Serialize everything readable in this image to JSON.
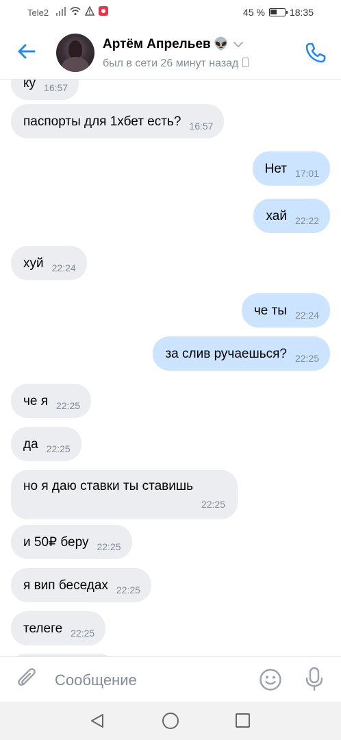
{
  "status_bar": {
    "carrier": "Tele2",
    "battery": "45 %",
    "time": "18:35"
  },
  "header": {
    "name": "Артём Апрельев",
    "emoji": "👽",
    "last_seen": "был в сети 26 минут назад"
  },
  "messages": [
    {
      "dir": "in",
      "text": "ку",
      "time": "16:57"
    },
    {
      "dir": "in",
      "text": "паспорты для 1хбет есть?",
      "time": "16:57"
    },
    {
      "dir": "out",
      "text": "Нет",
      "time": "17:01"
    },
    {
      "dir": "out",
      "text": "хай",
      "time": "22:22"
    },
    {
      "dir": "in",
      "text": "хуй",
      "time": "22:24"
    },
    {
      "dir": "out",
      "text": "че ты",
      "time": "22:24"
    },
    {
      "dir": "out",
      "text": "за слив ручаешься?",
      "time": "22:25"
    },
    {
      "dir": "in",
      "text": "че я",
      "time": "22:25"
    },
    {
      "dir": "in",
      "text": "да",
      "time": "22:25"
    },
    {
      "dir": "in",
      "text": "но я даю ставки ты ставишь",
      "time": "22:25"
    },
    {
      "dir": "in",
      "text": "и 50₽ беру",
      "time": "22:25"
    },
    {
      "dir": "in",
      "text": "я вип беседах",
      "time": "22:25"
    },
    {
      "dir": "in",
      "text": "телеге",
      "time": "22:25"
    }
  ],
  "composer": {
    "placeholder": "Сообщение"
  },
  "colors": {
    "accent": "#2688eb",
    "incoming": "#ebedf0",
    "outgoing": "#cce4ff",
    "secondary_text": "#818c99"
  }
}
